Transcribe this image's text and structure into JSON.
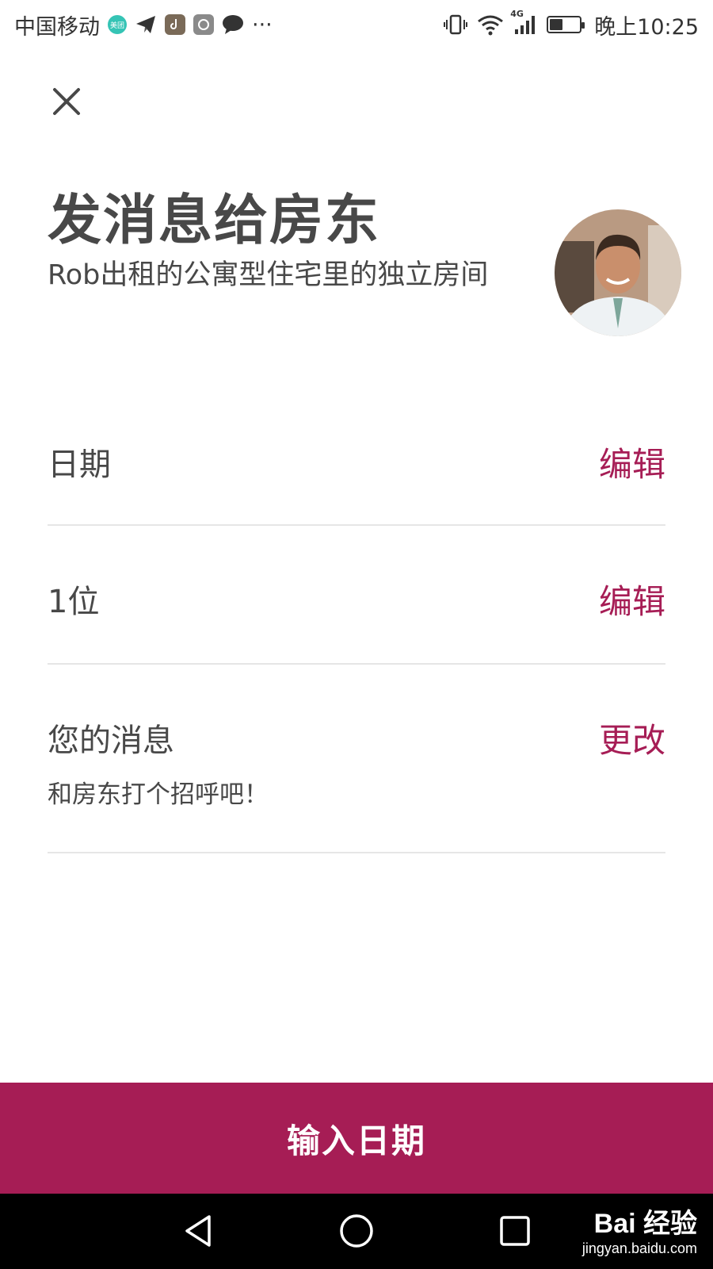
{
  "status_bar": {
    "carrier": "中国移动",
    "meituan_badge": "美团",
    "more": "···",
    "network": "4G",
    "time": "晚上10:25",
    "battery_level": 0.45,
    "icons": [
      "meituan-icon",
      "telegram-icon",
      "tiktok-icon",
      "app-icon",
      "chat-bubble-icon",
      "vibrate-icon",
      "wifi-icon",
      "signal-icon",
      "battery-icon"
    ]
  },
  "header": {
    "close_icon": "close-icon",
    "title": "发消息给房东",
    "subtitle": "Rob出租的公寓型住宅里的独立房间"
  },
  "rows": {
    "dates": {
      "label": "日期",
      "action": "编辑"
    },
    "guests": {
      "label": "1位",
      "action": "编辑"
    },
    "message": {
      "label": "您的消息",
      "action": "更改",
      "placeholder": "和房东打个招呼吧！"
    }
  },
  "cta": {
    "label": "输入日期"
  },
  "nav_bar": {
    "icons": [
      "back-triangle-icon",
      "home-circle-icon",
      "recents-square-icon"
    ],
    "watermark": {
      "main": "Bai 经验",
      "sub": "jingyan.baidu.com"
    }
  },
  "colors": {
    "accent": "#a61d55",
    "text": "#484848",
    "divider": "#e6e6e6"
  }
}
